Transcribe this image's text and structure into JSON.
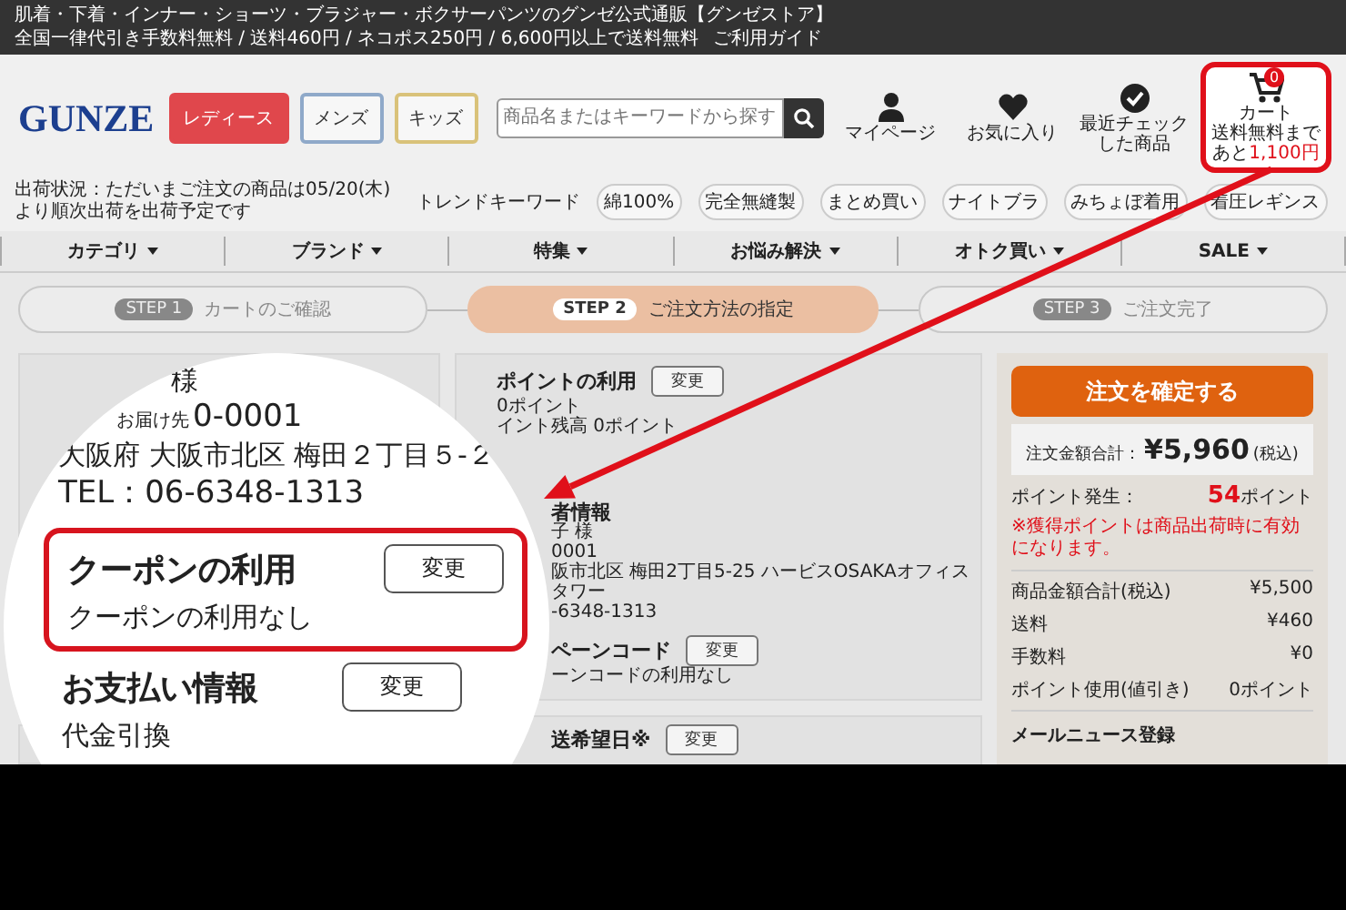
{
  "top_bar": {
    "title": "肌着・下着・インナー・ショーツ・ブラジャー・ボクサーパンツのグンゼ公式通販【グンゼストア】",
    "notice": "全国一律代引き手数料無料 / 送料460円 / ネコポス250円 / 6,600円以上で送料無料",
    "guide_link": "ご利用ガイド"
  },
  "header": {
    "logo": "GUNZE",
    "gender_tabs": [
      {
        "label": "レディース",
        "selected": true,
        "color": "#e0474c"
      },
      {
        "label": "メンズ",
        "selected": false,
        "color": "#8fa9c9"
      },
      {
        "label": "キッズ",
        "selected": false,
        "color": "#d9c27a"
      }
    ],
    "search": {
      "placeholder": "商品名またはキーワードから探す"
    },
    "shortcuts": [
      {
        "kind": "person",
        "label": "マイページ"
      },
      {
        "kind": "heart",
        "label": "お気に入り"
      },
      {
        "kind": "recent",
        "label": "最近チェックした商品"
      }
    ],
    "cart": {
      "label": "カート",
      "count": "0",
      "note": "送料無料まで",
      "note_prefix": "あと",
      "note_amount": "1,100円"
    },
    "status": "出荷状況：ただいまご注文の商品は05/20(木)より順次出荷を出荷予定です",
    "trend": {
      "label": "トレンドキーワード",
      "tags": [
        "綿100%",
        "完全無縫製",
        "まとめ買い",
        "ナイトブラ",
        "みちょぼ着用",
        "着圧レギンス"
      ]
    }
  },
  "nav": [
    "カテゴリ",
    "ブランド",
    "特集",
    "お悩み解決",
    "オトク買い",
    "SALE"
  ],
  "steps": [
    {
      "badge": "STEP 1",
      "label": "カートのご確認",
      "selected": false
    },
    {
      "badge": "STEP 2",
      "label": "ご注文方法の指定",
      "selected": true
    },
    {
      "badge": "STEP 3",
      "label": "ご注文完了",
      "selected": false
    }
  ],
  "magnifier": {
    "name_suffix": "様",
    "delivery_label": "お届け先",
    "zip": "0-0001",
    "address": "大阪府 大阪市北区 梅田２丁目５-２",
    "tel": "TEL：06-6348-1313",
    "coupon": {
      "title": "クーポンの利用",
      "button": "変更",
      "value": "クーポンの利用なし"
    },
    "payment": {
      "title": "お支払い情報",
      "button": "変更",
      "value": "代金引換"
    }
  },
  "middle": {
    "points": {
      "title": "ポイントの利用",
      "button": "変更",
      "lines": [
        "0ポイント",
        "イント残高 0ポイント"
      ]
    },
    "orderer": {
      "title": "者情報",
      "lines": [
        "子 様",
        "0001",
        "阪市北区 梅田2丁目5-25 ハービスOSAKAオフィスタワー",
        "-6348-1313"
      ]
    },
    "campaign": {
      "title": "ペーンコード",
      "button": "変更",
      "value": "ーンコードの利用なし"
    },
    "delivery_date": {
      "title": "送希望日※",
      "button": "変更"
    }
  },
  "summary": {
    "confirm_button": "注文を確定する",
    "total_label": "注文金額合計：",
    "total": "¥5,960",
    "total_note": "(税込)",
    "points_label": "ポイント発生：",
    "points_value": "54",
    "points_unit": "ポイント",
    "points_note": "※獲得ポイントは商品出荷時に有効になります。",
    "rows": [
      {
        "label": "商品金額合計(税込)",
        "value": "¥5,500"
      },
      {
        "label": "送料",
        "value": "¥460"
      },
      {
        "label": "手数料",
        "value": "¥0"
      },
      {
        "label": "ポイント使用(値引き)",
        "value": "0ポイント"
      }
    ],
    "newsletter": "メールニュース登録"
  }
}
